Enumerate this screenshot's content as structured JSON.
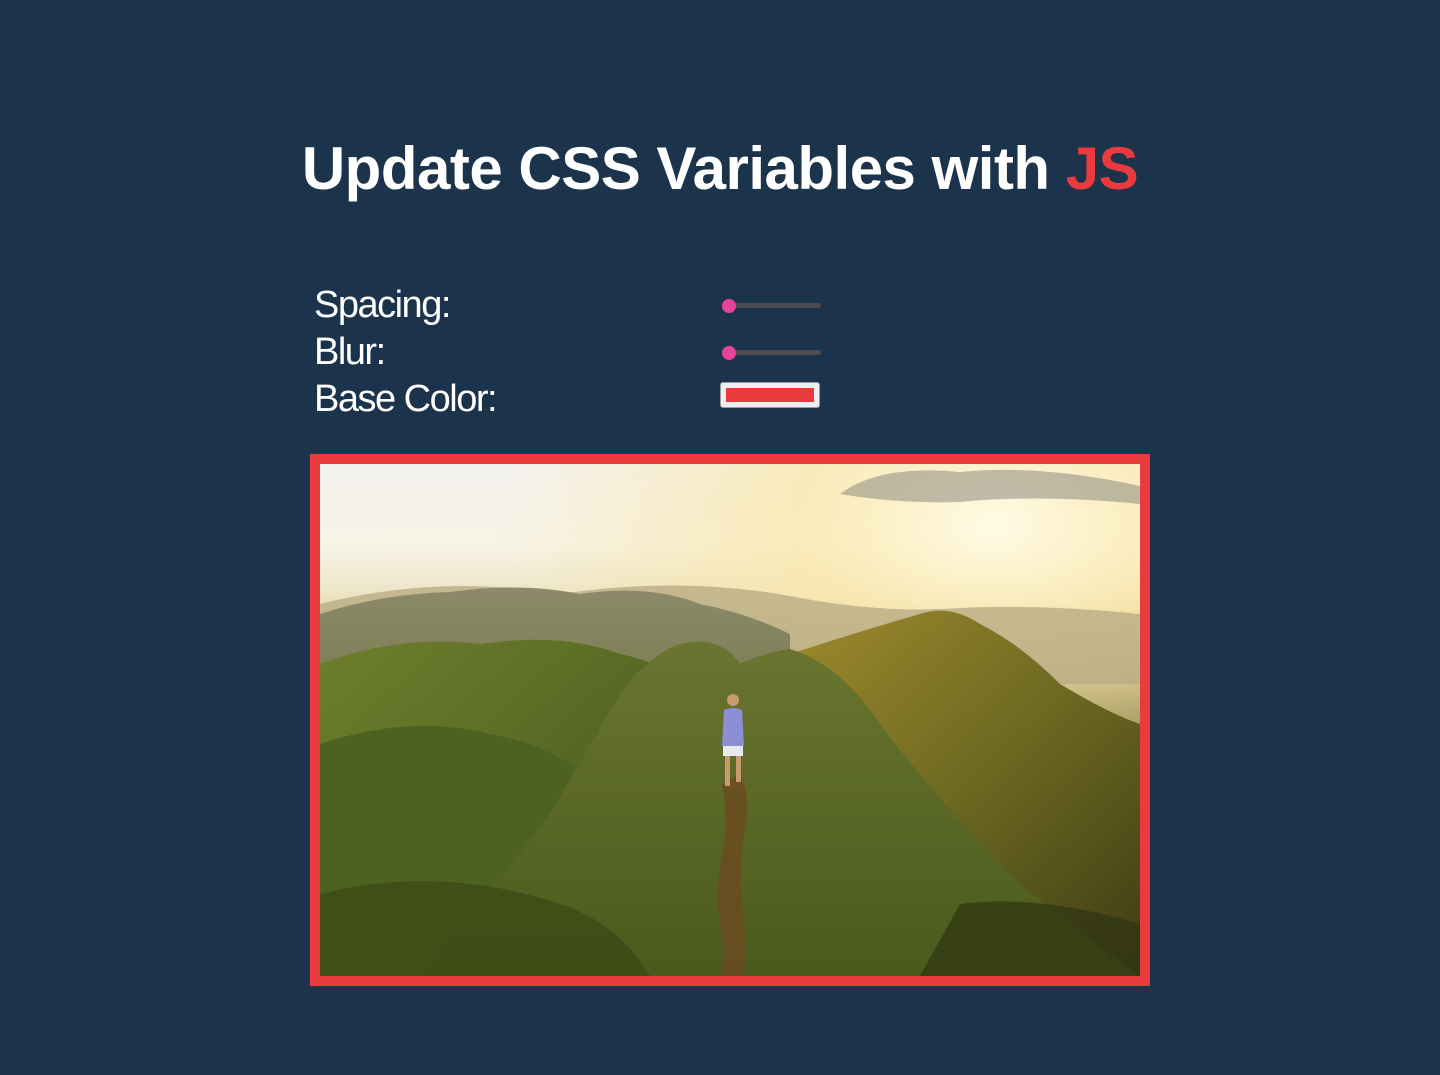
{
  "header": {
    "title_main": "Update CSS Variables with ",
    "title_accent": "JS"
  },
  "controls": {
    "spacing": {
      "label": "Spacing:",
      "value": 10,
      "min": 10,
      "max": 200
    },
    "blur": {
      "label": "Blur:",
      "value": 0,
      "min": 0,
      "max": 25
    },
    "base_color": {
      "label": "Base Color:",
      "value": "#e93b3e"
    }
  },
  "photo": {
    "icon": "mountain-hiker-photo"
  },
  "colors": {
    "background": "#1b344b",
    "accent": "#e93b3e",
    "slider_thumb": "#e8439c",
    "text": "#ffffff"
  }
}
